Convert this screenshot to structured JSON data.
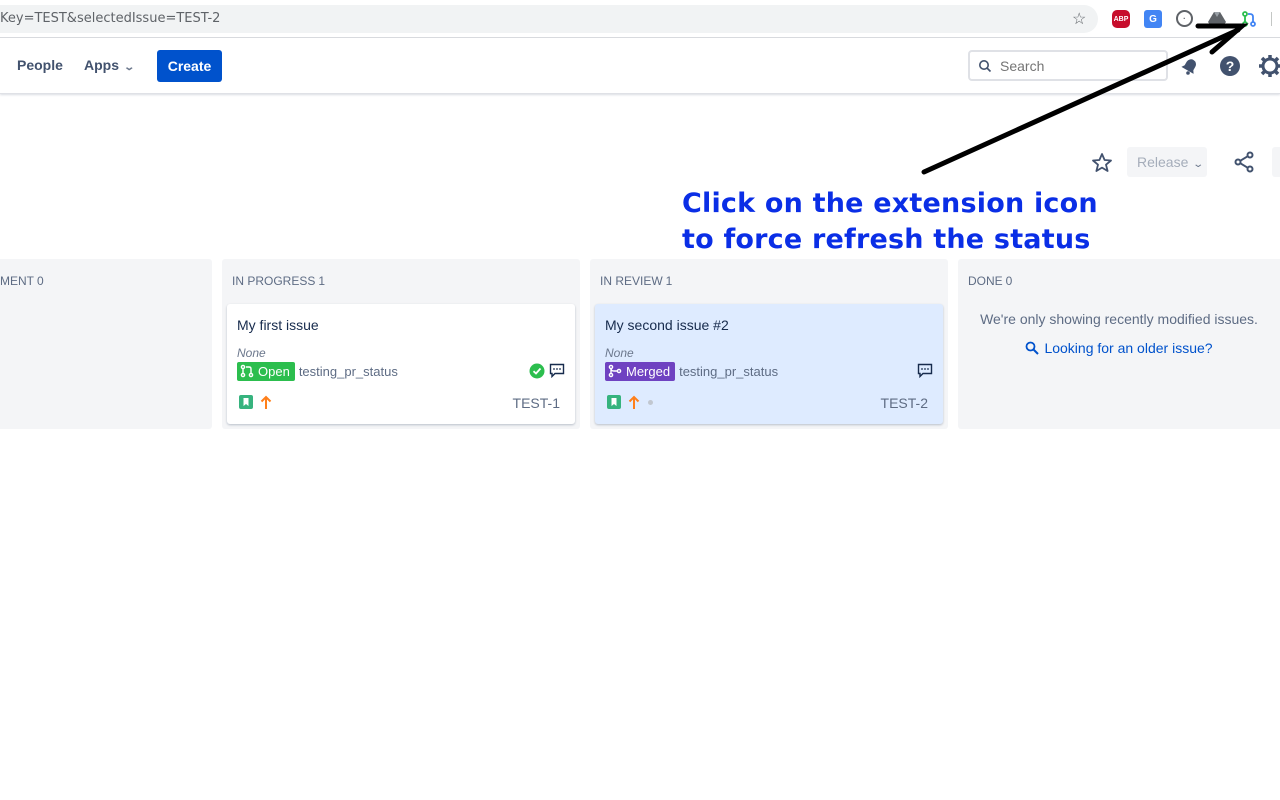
{
  "browser": {
    "url": "Key=TEST&selectedIssue=TEST-2",
    "extensions": [
      "adblock-plus-icon",
      "google-translate-icon",
      "circle-extension-icon",
      "drive-icon",
      "pr-status-extension-icon"
    ],
    "abp_label": "ABP"
  },
  "header": {
    "people_label": "People",
    "apps_label": "Apps",
    "create_label": "Create",
    "search_placeholder": "Search"
  },
  "toolbar": {
    "release_label": "Release"
  },
  "annotation": {
    "line1": "Click on the extension icon",
    "line2": "to force refresh the status",
    "color": "#0a2ee6"
  },
  "board": {
    "columns": [
      {
        "title": "MENT",
        "count": "0"
      },
      {
        "title": "IN PROGRESS",
        "count": "1"
      },
      {
        "title": "IN REVIEW",
        "count": "1"
      },
      {
        "title": "DONE",
        "count": "0"
      }
    ],
    "cards": [
      {
        "title": "My first issue",
        "assignee": "None",
        "pr_status": "Open",
        "pr_status_color": "#2cbe4e",
        "branch": "testing_pr_status",
        "key": "TEST-1",
        "has_check": true
      },
      {
        "title": "My second issue #2",
        "assignee": "None",
        "pr_status": "Merged",
        "pr_status_color": "#6f42c1",
        "branch": "testing_pr_status",
        "key": "TEST-2",
        "has_check": false
      }
    ],
    "done": {
      "message": "We're only showing recently modified issues.",
      "link": "Looking for an older issue?"
    }
  }
}
